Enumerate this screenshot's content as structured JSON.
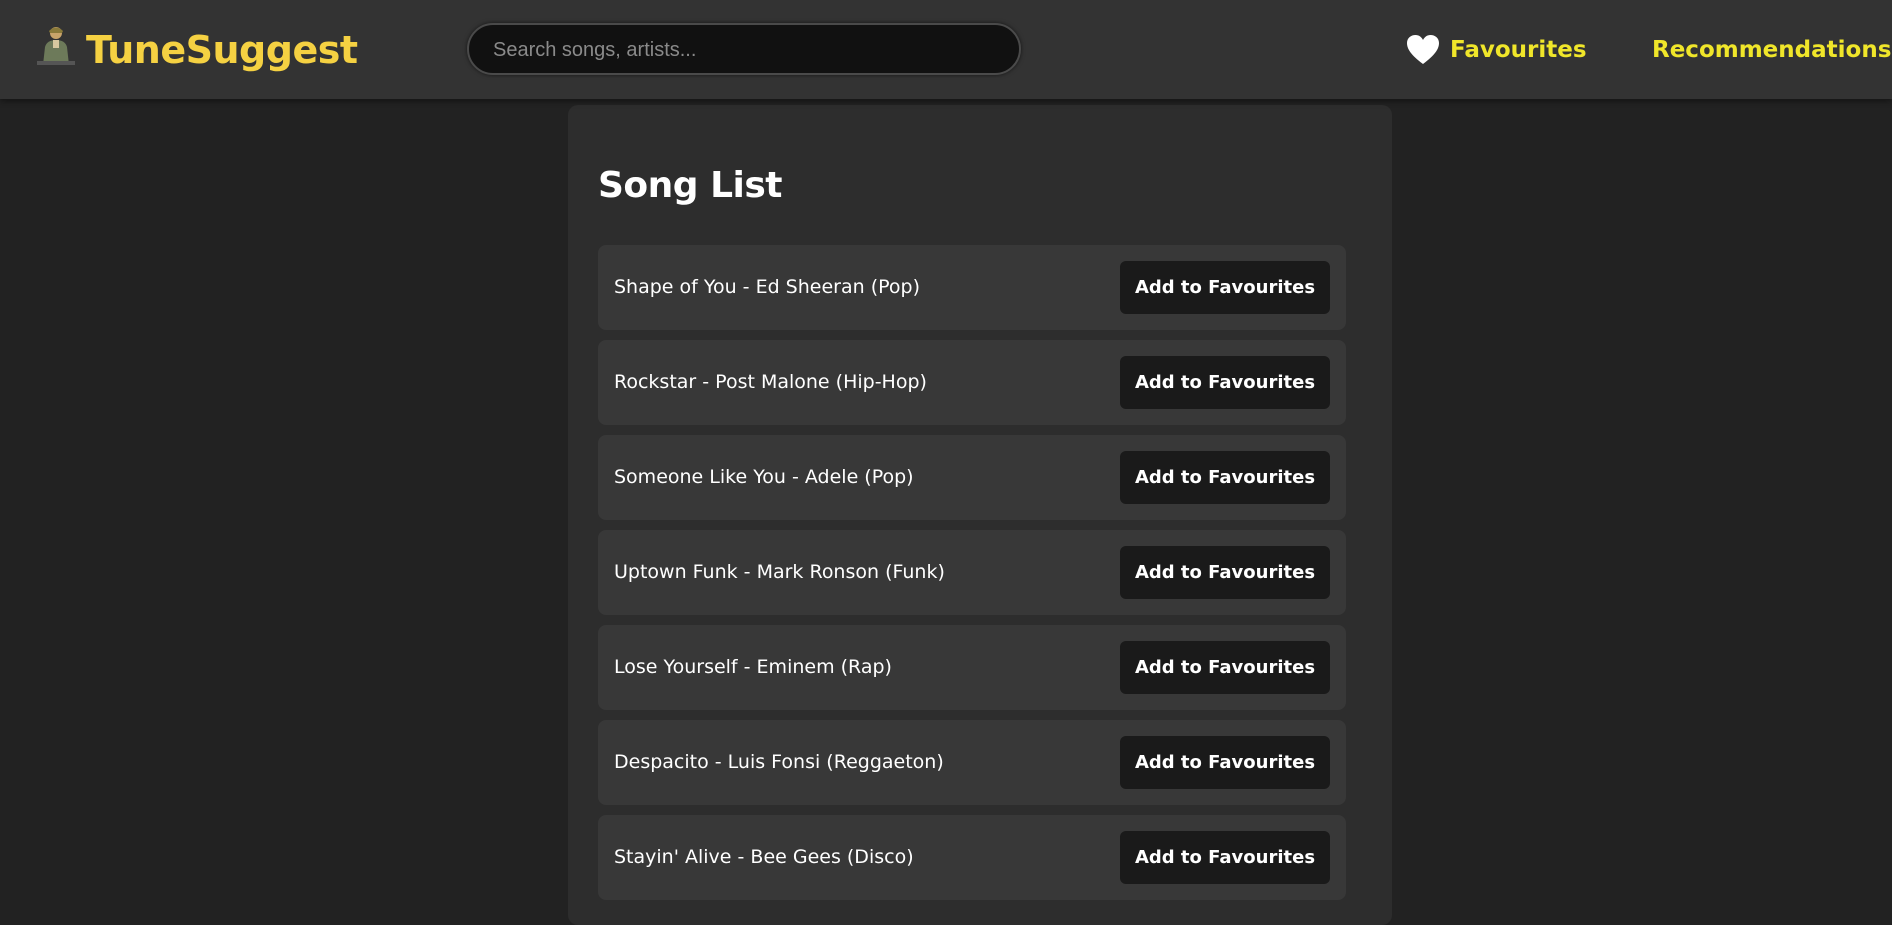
{
  "header": {
    "brand": "TuneSuggest",
    "search": {
      "placeholder": "Search songs, artists...",
      "value": ""
    },
    "nav": {
      "favourites_label": "Favourites",
      "recommendations_label": "Recommendations"
    }
  },
  "main": {
    "title": "Song List",
    "add_button_label": "Add to Favourites",
    "songs": [
      "Shape of You - Ed Sheeran (Pop)",
      "Rockstar - Post Malone (Hip-Hop)",
      "Someone Like You - Adele (Pop)",
      "Uptown Funk - Mark Ronson (Funk)",
      "Lose Yourself - Eminem (Rap)",
      "Despacito - Luis Fonsi (Reggaeton)",
      "Stayin' Alive - Bee Gees (Disco)"
    ]
  },
  "colors": {
    "brand": "#f5d142",
    "nav_link": "#f0e62a",
    "header_bg": "#333333",
    "page_bg": "#222222",
    "panel_bg": "#2d2d2d",
    "row_bg": "#383838",
    "button_bg": "#1a1a1a"
  },
  "icons": {
    "logo": "avatar-icon",
    "favourites": "heart-icon"
  }
}
